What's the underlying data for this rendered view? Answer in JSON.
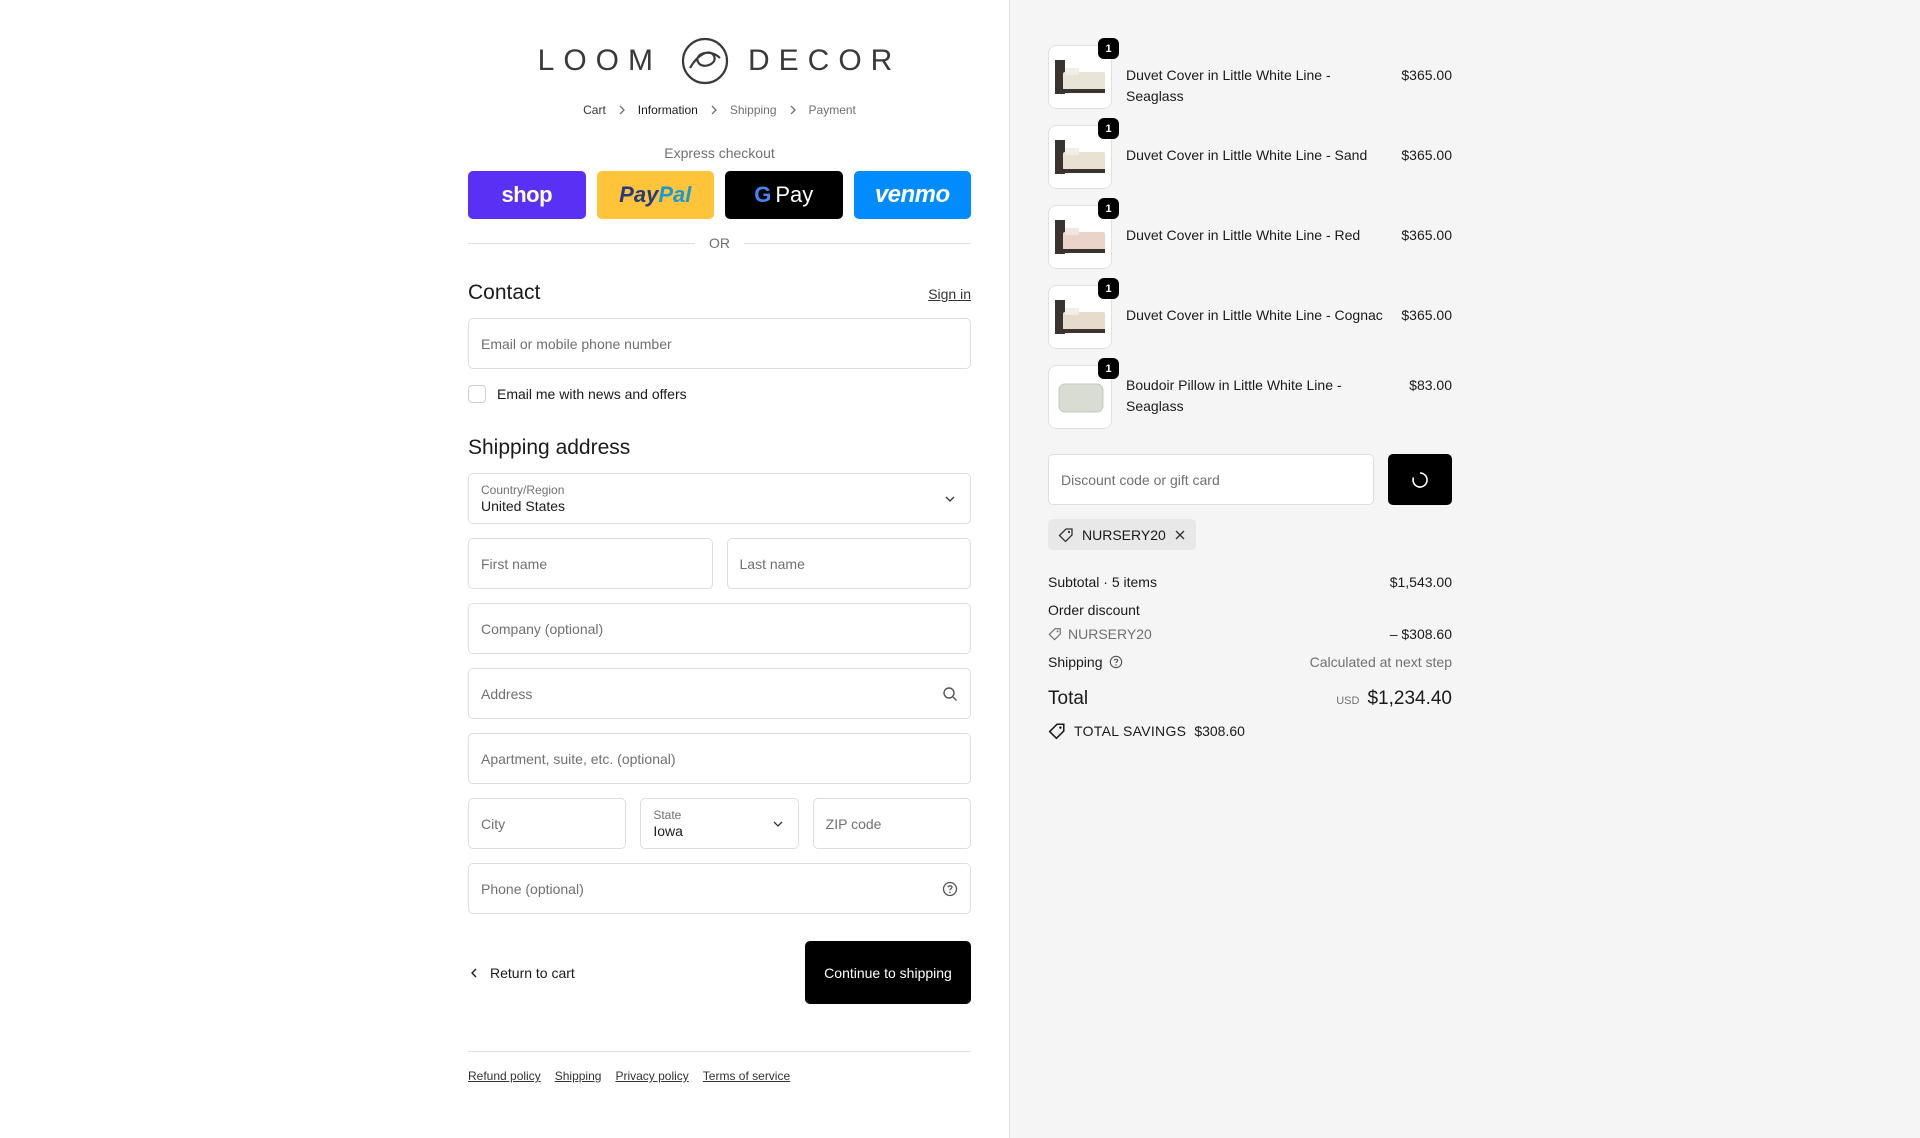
{
  "brand": {
    "left": "LOOM",
    "right": "DECOR"
  },
  "breadcrumb": {
    "cart": "Cart",
    "information": "Information",
    "shipping": "Shipping",
    "payment": "Payment"
  },
  "express": {
    "title": "Express checkout",
    "shop": "shop",
    "paypal_a": "Pay",
    "paypal_b": "Pal",
    "gpay_g": "G",
    "gpay": "Pay",
    "venmo": "venmo",
    "or": "OR"
  },
  "contact": {
    "title": "Contact",
    "sign_in": "Sign in",
    "email_placeholder": "Email or mobile phone number",
    "news_label": "Email me with news and offers"
  },
  "shipping_address": {
    "title": "Shipping address",
    "country_label": "Country/Region",
    "country_value": "United States",
    "first_name": "First name",
    "last_name": "Last name",
    "company": "Company (optional)",
    "address": "Address",
    "apartment": "Apartment, suite, etc. (optional)",
    "city": "City",
    "state_label": "State",
    "state_value": "Iowa",
    "zip": "ZIP code",
    "phone": "Phone (optional)"
  },
  "actions": {
    "return": "Return to cart",
    "continue": "Continue to shipping"
  },
  "footer": {
    "refund": "Refund policy",
    "shipping": "Shipping",
    "privacy": "Privacy policy",
    "terms": "Terms of service"
  },
  "items": [
    {
      "name": "Duvet Cover in Little White Line - Seaglass",
      "price": "$365.00",
      "qty": "1",
      "color": "#e8e4d8"
    },
    {
      "name": "Duvet Cover in Little White Line - Sand",
      "price": "$365.00",
      "qty": "1",
      "color": "#e9e2d2"
    },
    {
      "name": "Duvet Cover in Little White Line - Red",
      "price": "$365.00",
      "qty": "1",
      "color": "#ead3c8"
    },
    {
      "name": "Duvet Cover in Little White Line - Cognac",
      "price": "$365.00",
      "qty": "1",
      "color": "#e7dccb"
    },
    {
      "name": "Boudoir Pillow in Little White Line - Seaglass",
      "price": "$83.00",
      "qty": "1",
      "color": "#d8dcd2"
    }
  ],
  "discount": {
    "placeholder": "Discount code or gift card",
    "code": "NURSERY20"
  },
  "totals": {
    "subtotal_label": "Subtotal · 5 items",
    "subtotal": "$1,543.00",
    "order_discount_label": "Order discount",
    "discount_code": "NURSERY20",
    "discount_value": "– $308.60",
    "shipping_label": "Shipping",
    "shipping_value": "Calculated at next step",
    "total_label": "Total",
    "currency": "USD",
    "total": "$1,234.40",
    "savings_label": "TOTAL SAVINGS",
    "savings_value": "$308.60"
  }
}
